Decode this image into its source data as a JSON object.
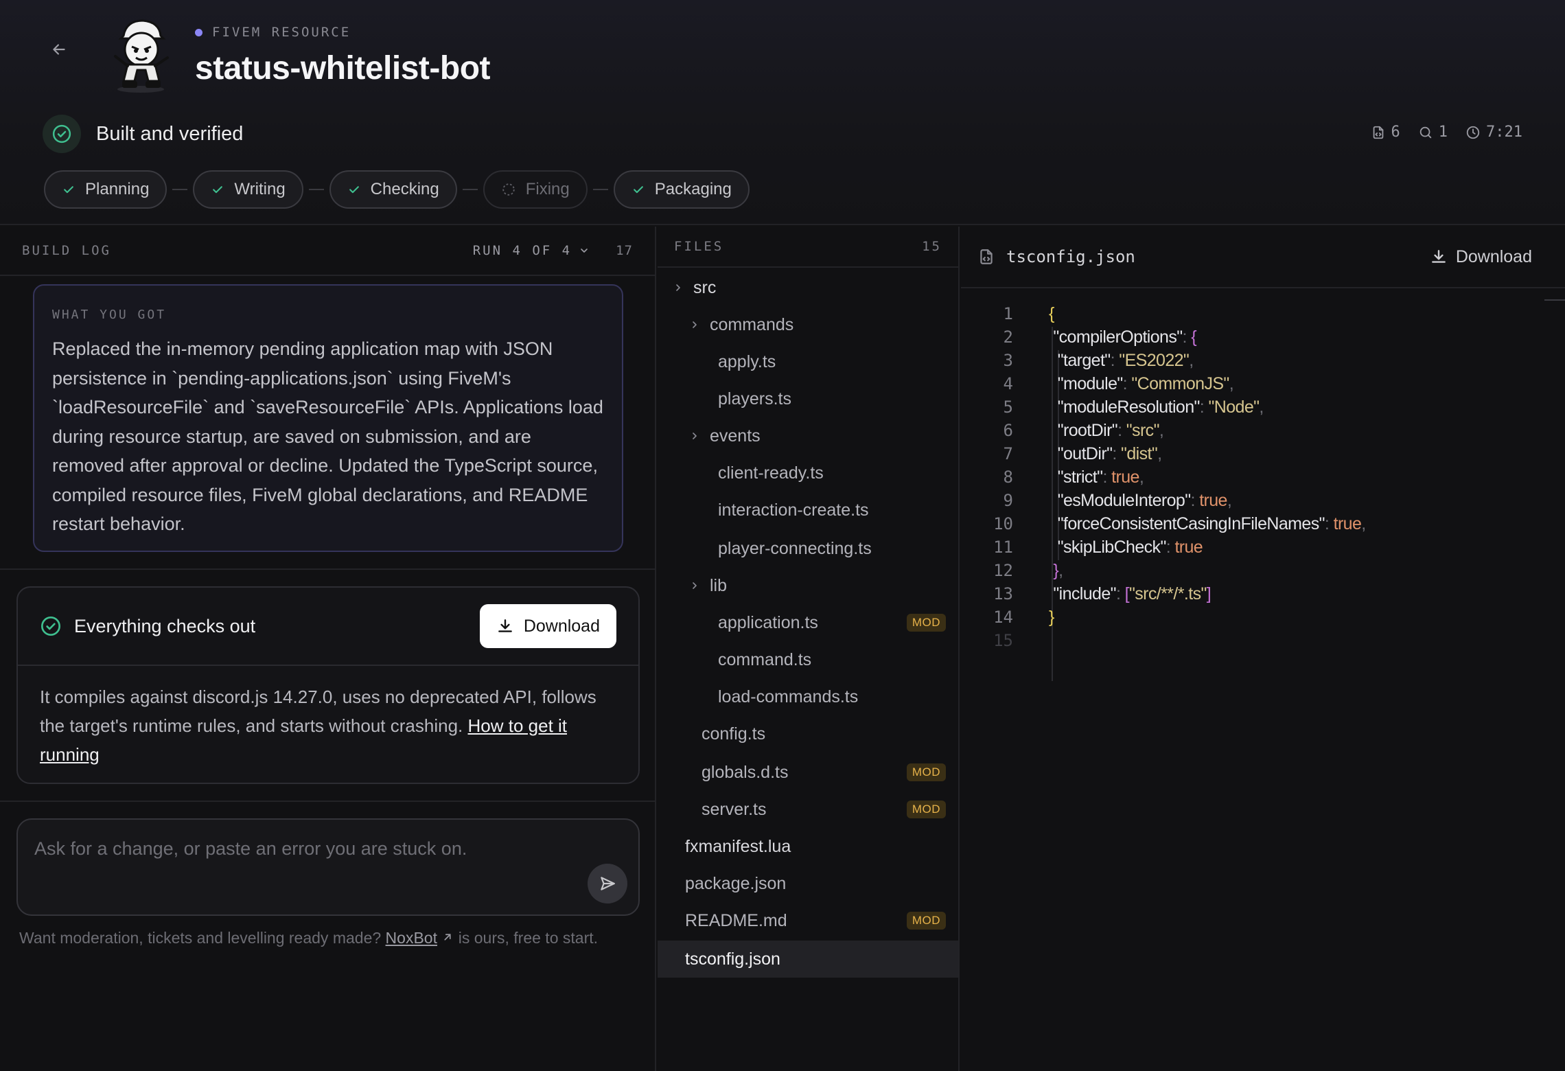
{
  "header": {
    "eyebrow": "FIVEM RESOURCE",
    "title": "status-whitelist-bot",
    "status": "Built and verified",
    "stats": {
      "files": "6",
      "issues": "1",
      "time": "7:21"
    },
    "steps": [
      {
        "label": "Planning",
        "state": "done"
      },
      {
        "label": "Writing",
        "state": "done"
      },
      {
        "label": "Checking",
        "state": "done"
      },
      {
        "label": "Fixing",
        "state": "pending"
      },
      {
        "label": "Packaging",
        "state": "done"
      }
    ]
  },
  "log": {
    "heading": "BUILD LOG",
    "run": "RUN 4 OF 4",
    "count": "17",
    "summary_label": "WHAT YOU GOT",
    "summary": "Replaced the in-memory pending application map with JSON persistence in `pending-applications.json` using FiveM's `loadResourceFile` and `saveResourceFile` APIs. Applications load during resource startup, are saved on submission, and are removed after approval or decline. Updated the TypeScript source, compiled resource files, FiveM global declarations, and README restart behavior.",
    "result_title": "Everything checks out",
    "download_label": "Download",
    "result_body": "It compiles against discord.js 14.27.0, uses no deprecated API, follows the target's runtime rules, and starts without crashing.",
    "result_link": "How to get it running",
    "ask_placeholder": "Ask for a change, or paste an error you are stuck on.",
    "promo_before": "Want moderation, tickets and levelling ready made?",
    "promo_link": "NoxBot",
    "promo_after": "is ours, free to start."
  },
  "files": {
    "heading": "FILES",
    "count": "15",
    "mod_label": "MOD",
    "tree": [
      {
        "name": "src",
        "type": "folder"
      },
      {
        "name": "commands",
        "type": "folder"
      },
      {
        "name": "apply.ts",
        "type": "file"
      },
      {
        "name": "players.ts",
        "type": "file"
      },
      {
        "name": "events",
        "type": "folder"
      },
      {
        "name": "client-ready.ts",
        "type": "file"
      },
      {
        "name": "interaction-create.ts",
        "type": "file"
      },
      {
        "name": "player-connecting.ts",
        "type": "file"
      },
      {
        "name": "lib",
        "type": "folder"
      },
      {
        "name": "application.ts",
        "type": "file",
        "modified": true
      },
      {
        "name": "command.ts",
        "type": "file"
      },
      {
        "name": "load-commands.ts",
        "type": "file"
      },
      {
        "name": "config.ts",
        "type": "file"
      },
      {
        "name": "globals.d.ts",
        "type": "file",
        "modified": true
      },
      {
        "name": "server.ts",
        "type": "file",
        "modified": true
      },
      {
        "name": "fxmanifest.lua",
        "type": "file"
      },
      {
        "name": "package.json",
        "type": "file"
      },
      {
        "name": "README.md",
        "type": "file",
        "modified": true
      },
      {
        "name": "tsconfig.json",
        "type": "file",
        "selected": true
      }
    ]
  },
  "editor": {
    "filename": "tsconfig.json",
    "download_label": "Download",
    "line_numbers": [
      "1",
      "2",
      "3",
      "4",
      "5",
      "6",
      "7",
      "8",
      "9",
      "10",
      "11",
      "12",
      "13",
      "14",
      "15"
    ],
    "code": {
      "k_compilerOptions": "\"compilerOptions\"",
      "k_target": "\"target\"",
      "v_target": "\"ES2022\"",
      "k_module": "\"module\"",
      "v_module": "\"CommonJS\"",
      "k_moduleResolution": "\"moduleResolution\"",
      "v_moduleResolution": "\"Node\"",
      "k_rootDir": "\"rootDir\"",
      "v_rootDir": "\"src\"",
      "k_outDir": "\"outDir\"",
      "v_outDir": "\"dist\"",
      "k_strict": "\"strict\"",
      "v_strict": "true",
      "k_esModuleInterop": "\"esModuleInterop\"",
      "v_esModuleInterop": "true",
      "k_forceConsistent": "\"forceConsistentCasingInFileNames\"",
      "v_forceConsistent": "true",
      "k_skipLibCheck": "\"skipLibCheck\"",
      "v_skipLibCheck": "true",
      "k_include": "\"include\"",
      "v_include": "\"src/**/*.ts\""
    }
  },
  "colors": {
    "accent": "#8b86f5",
    "success": "#3fbf8f",
    "mod": "#e6b24a"
  }
}
